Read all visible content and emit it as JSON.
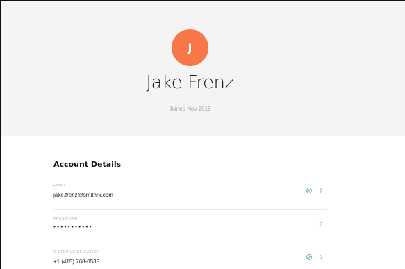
{
  "profile": {
    "avatar_initial": "J",
    "name": "Jake Frenz",
    "joined": "Joined Nov 2019"
  },
  "account_details": {
    "title": "Account Details",
    "rows": [
      {
        "label": "EMAIL",
        "value": "jake.frenz@smithrx.com",
        "verified": true
      },
      {
        "label": "PASSWORD",
        "value": "•••••••••••",
        "verified": false
      },
      {
        "label": "2-STEP VERIFICATION",
        "value": "+1 (415) 768-0538",
        "verified": true
      }
    ]
  },
  "colors": {
    "avatar_bg": "#f77748",
    "header_bg": "#f4f4f4",
    "check_green": "#3a9a63",
    "chevron_gray": "#9a9a9a"
  },
  "icons": {
    "verified": "check-circle-icon",
    "navigate": "chevron-right-icon"
  }
}
